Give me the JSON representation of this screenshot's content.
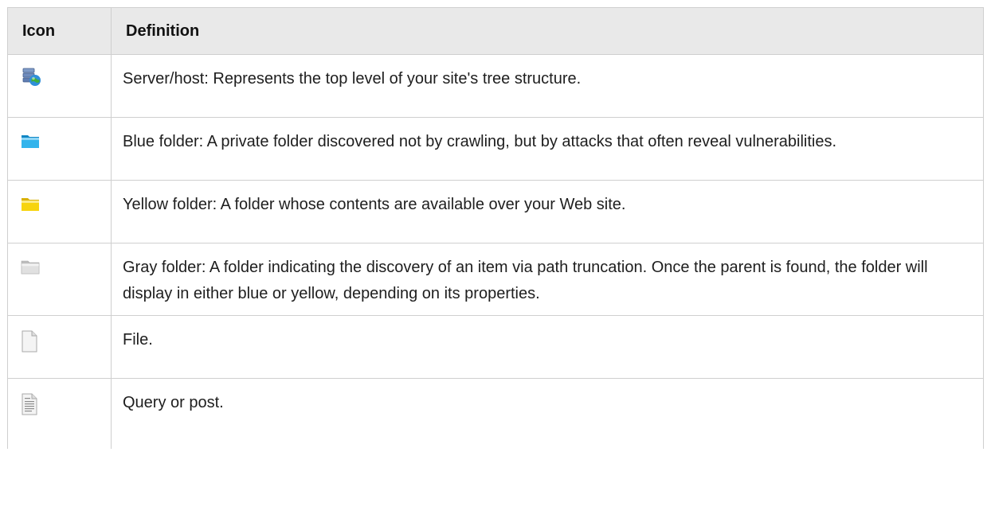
{
  "table": {
    "headers": {
      "icon": "Icon",
      "definition": "Definition"
    },
    "rows": [
      {
        "icon": "server-host-icon",
        "definition": "Server/host: Represents the top level of your site's tree structure."
      },
      {
        "icon": "blue-folder-icon",
        "definition": "Blue folder: A private folder discovered not by crawling, but by attacks that often reveal vulnerabilities."
      },
      {
        "icon": "yellow-folder-icon",
        "definition": "Yellow folder: A folder whose contents are available over your Web site."
      },
      {
        "icon": "gray-folder-icon",
        "definition": "Gray folder: A folder indicating the discovery of an item via path truncation. Once the parent is found, the folder will display in either blue or yellow, depending on its properties."
      },
      {
        "icon": "file-icon",
        "definition": "File."
      },
      {
        "icon": "query-post-icon",
        "definition": "Query or post."
      }
    ]
  },
  "colors": {
    "header_bg": "#e9e9e9",
    "border": "#cfcfcf",
    "blue_folder": "#1ea7e1",
    "yellow_folder": "#f5d000",
    "gray_folder": "#d9d9d9"
  }
}
